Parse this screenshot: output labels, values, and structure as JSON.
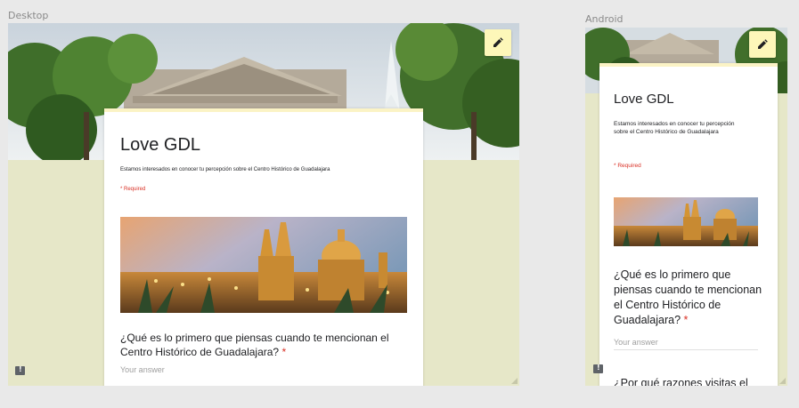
{
  "frames": {
    "desktop_label": "Desktop",
    "android_label": "Android"
  },
  "form": {
    "title": "Love GDL",
    "description": "Estamos interesados en conocer tu percepción sobre el Centro Histórico de Guadalajara",
    "required_note": "* Required",
    "question1": "¿Qué es lo primero que piensas cuando te mencionan el Centro Histórico de Guadalajara?",
    "question1_required": "*",
    "answer_placeholder": "Your answer",
    "question2_partial": "¿Por qué razones visitas el"
  },
  "icons": {
    "edit": "pencil-icon",
    "feedback": "feedback-icon",
    "resize": "resize-handle-icon"
  },
  "colors": {
    "background": "#e6e7c8",
    "card_accent": "#fbf3c5",
    "edit_button": "#fdf7b9",
    "required": "#d93025"
  }
}
